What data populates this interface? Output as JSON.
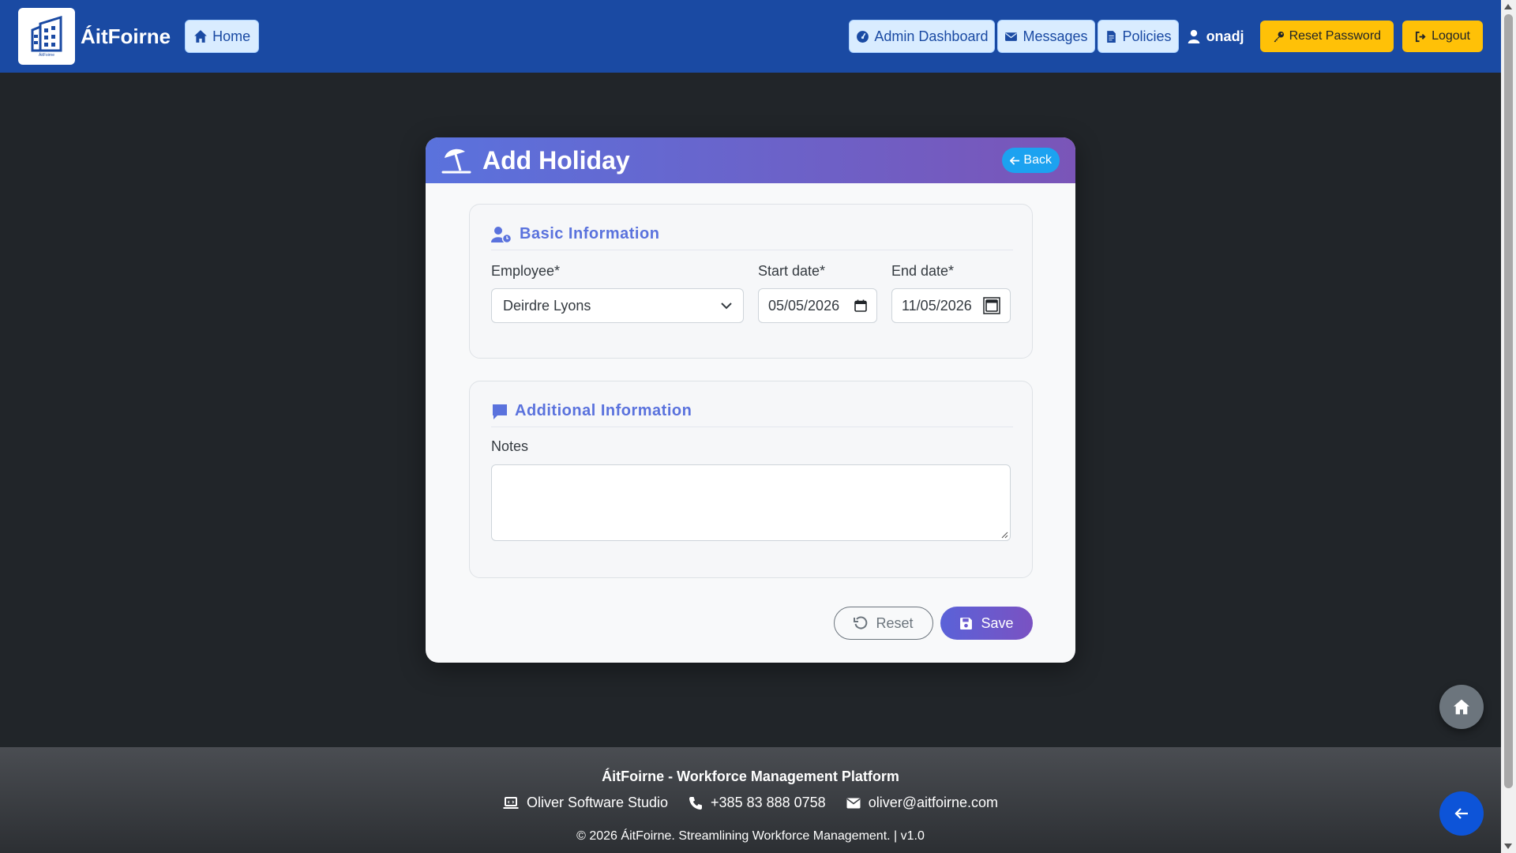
{
  "navbar": {
    "brand_name": "ÁitFoirne",
    "logo_caption": "ÁitFoirne",
    "home_label": "Home",
    "admin_label": "Admin Dashboard",
    "messages_label": "Messages",
    "policies_label": "Policies",
    "username": "onadj",
    "reset_password_label": "Reset Password",
    "logout_label": "Logout",
    "colors": {
      "background": "#1a4aa3",
      "pill": "#d9ecff",
      "warning": "#ffc107"
    }
  },
  "form": {
    "title": "Add Holiday",
    "back_label": "Back",
    "basic": {
      "title": "Basic Information",
      "employee_label": "Employee*",
      "employee_value": "Deirdre Lyons",
      "start_label": "Start date*",
      "start_value": "05/05/2026",
      "end_label": "End date*",
      "end_value": "11/05/2026"
    },
    "additional": {
      "title": "Additional Information",
      "notes_label": "Notes",
      "notes_value": ""
    },
    "reset_label": "Reset",
    "save_label": "Save",
    "colors": {
      "header_start": "#5a72dd",
      "header_end": "#7a55b8",
      "back": "#1ca2f0",
      "accent": "#5a72dd"
    }
  },
  "footer": {
    "brandline": "ÁitFoirne - Workforce Management Platform",
    "studio": "Oliver Software Studio",
    "phone": "+385 83 888 0758",
    "email": "oliver@aitfoirne.com",
    "copyright": "© 2026 ÁitFoirne. Streamlining Workforce Management. | v1.0"
  }
}
